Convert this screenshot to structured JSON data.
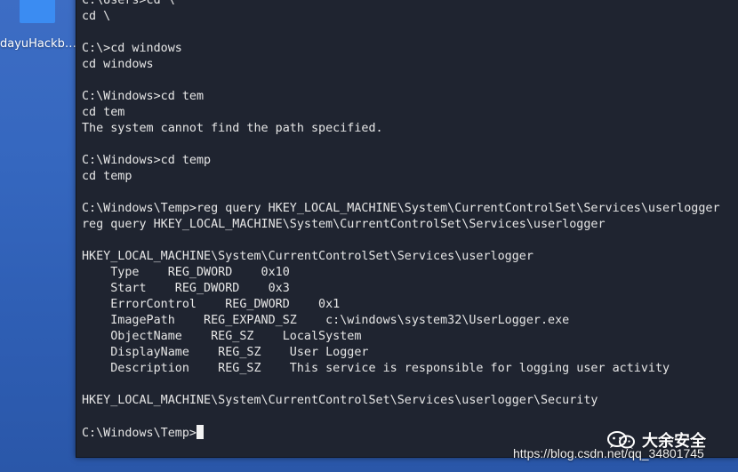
{
  "desktop": {
    "icon_label": "dayuHackba..."
  },
  "terminal": {
    "lines": [
      "C:\\Users>cd \\",
      "cd \\",
      "",
      "C:\\>cd windows",
      "cd windows",
      "",
      "C:\\Windows>cd tem",
      "cd tem",
      "The system cannot find the path specified.",
      "",
      "C:\\Windows>cd temp",
      "cd temp",
      "",
      "C:\\Windows\\Temp>reg query HKEY_LOCAL_MACHINE\\System\\CurrentControlSet\\Services\\userlogger",
      "reg query HKEY_LOCAL_MACHINE\\System\\CurrentControlSet\\Services\\userlogger",
      "",
      "HKEY_LOCAL_MACHINE\\System\\CurrentControlSet\\Services\\userlogger",
      "    Type    REG_DWORD    0x10",
      "    Start    REG_DWORD    0x3",
      "    ErrorControl    REG_DWORD    0x1",
      "    ImagePath    REG_EXPAND_SZ    c:\\windows\\system32\\UserLogger.exe",
      "    ObjectName    REG_SZ    LocalSystem",
      "    DisplayName    REG_SZ    User Logger",
      "    Description    REG_SZ    This service is responsible for logging user activity",
      "",
      "HKEY_LOCAL_MACHINE\\System\\CurrentControlSet\\Services\\userlogger\\Security",
      ""
    ],
    "prompt": "C:\\Windows\\Temp>"
  },
  "watermark": {
    "text": "大余安全",
    "icon": "wechat-icon"
  },
  "csdn_url": "https://blog.csdn.net/qq_34801745",
  "colors": {
    "terminal_bg": "#1f2430",
    "terminal_text": "#e6e6e6",
    "desktop_bg": "#3567bf",
    "folder": "#3b8cf2"
  }
}
